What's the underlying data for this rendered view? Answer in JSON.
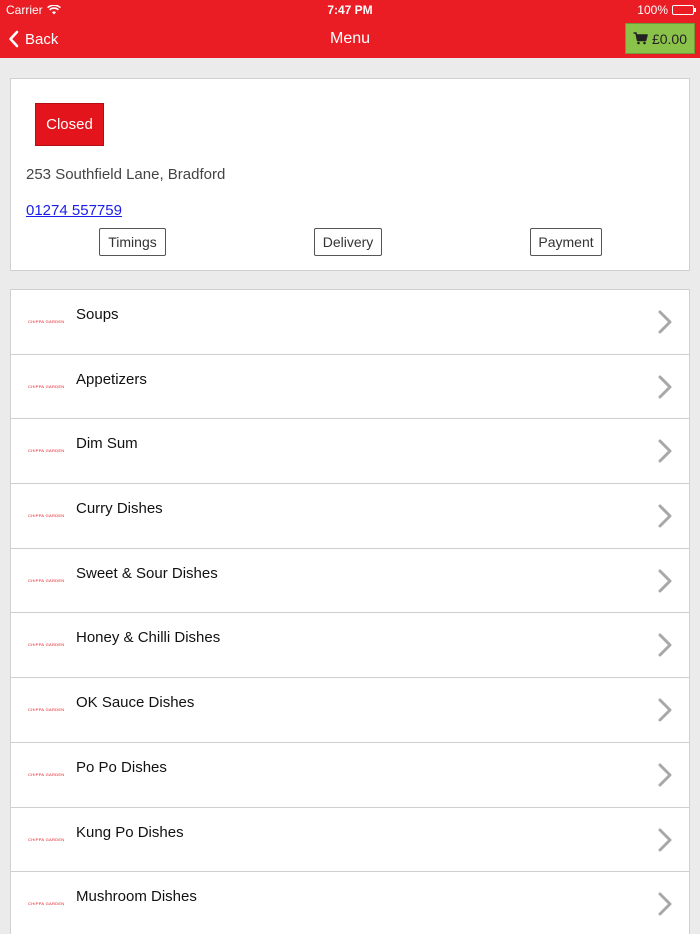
{
  "status_bar": {
    "carrier": "Carrier",
    "time": "7:47 PM",
    "battery": "100%"
  },
  "nav": {
    "back_label": "Back",
    "title": "Menu",
    "cart_total": "£0.00"
  },
  "restaurant": {
    "status": "Closed",
    "address": "253 Southfield Lane, Bradford",
    "phone": "01274 557759",
    "buttons": [
      "Timings",
      "Delivery",
      "Payment"
    ]
  },
  "menu": {
    "logo_text": "CHIPPA GARDEN",
    "categories": [
      "Soups",
      "Appetizers",
      "Dim Sum",
      "Curry Dishes",
      "Sweet & Sour Dishes",
      "Honey & Chilli Dishes",
      "OK Sauce Dishes",
      "Po Po Dishes",
      "Kung Po Dishes",
      "Mushroom Dishes"
    ]
  },
  "colors": {
    "header": "#ea1c24",
    "cart": "#8bc34a",
    "closed": "#e3141c"
  }
}
